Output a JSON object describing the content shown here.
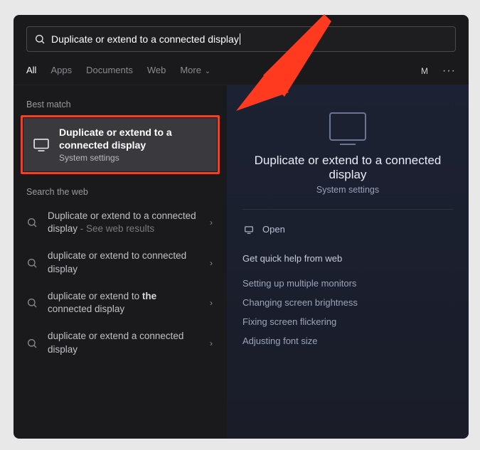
{
  "search": {
    "query": "Duplicate or extend to a connected display"
  },
  "tabs": {
    "items": [
      "All",
      "Apps",
      "Documents",
      "Web",
      "More"
    ],
    "active_index": 0
  },
  "account": {
    "initial": "M"
  },
  "left": {
    "best_match_label": "Best match",
    "best_match": {
      "title": "Duplicate or extend to a connected display",
      "subtitle": "System settings"
    },
    "search_web_label": "Search the web",
    "web_results": [
      {
        "text": "Duplicate or extend to a connected display",
        "hint": " - See web results",
        "bold": ""
      },
      {
        "text": "duplicate or extend to connected display",
        "hint": "",
        "bold": ""
      },
      {
        "text_pre": "duplicate or extend to ",
        "bold": "the",
        "text_post": " connected display",
        "hint": ""
      },
      {
        "text": "duplicate or extend a connected display",
        "hint": "",
        "bold": ""
      }
    ]
  },
  "right": {
    "title": "Duplicate or extend to a connected display",
    "subtitle": "System settings",
    "open_label": "Open",
    "quick_help_label": "Get quick help from web",
    "quick_links": [
      "Setting up multiple monitors",
      "Changing screen brightness",
      "Fixing screen flickering",
      "Adjusting font size"
    ]
  },
  "colors": {
    "highlight_border": "#ff3b1f",
    "arrow": "#ff3a1e"
  }
}
